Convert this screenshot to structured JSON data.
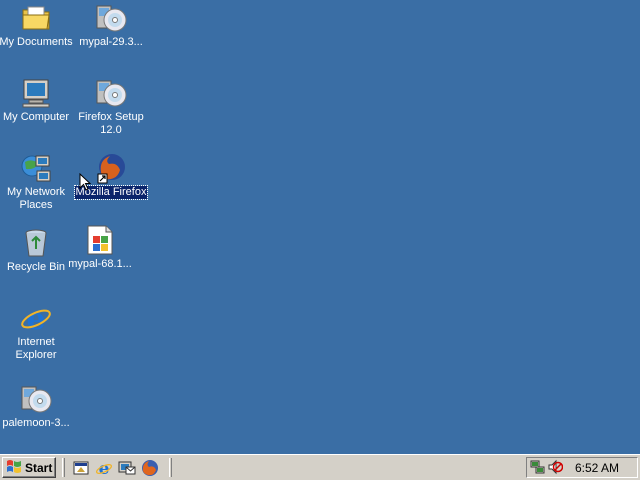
{
  "desktop": {
    "background_color": "#3a6ea5",
    "icons": [
      {
        "label": "My Documents",
        "icon": "folder-documents-icon"
      },
      {
        "label": "mypal-29.3...",
        "icon": "installer-cd-icon"
      },
      {
        "label": "My Computer",
        "icon": "computer-monitor-icon"
      },
      {
        "label": "Firefox Setup 12.0",
        "icon": "installer-cd-icon"
      },
      {
        "label": "My Network Places",
        "icon": "network-places-icon"
      },
      {
        "label": "Mozilla Firefox",
        "icon": "firefox-shortcut-icon",
        "selected": true
      },
      {
        "label": "Recycle Bin",
        "icon": "recycle-bin-icon"
      },
      {
        "label": "mypal-68.1...",
        "icon": "windows-installer-file-icon"
      },
      {
        "label": "Internet Explorer",
        "icon": "internet-explorer-icon"
      },
      {
        "label": "palemoon-3...",
        "icon": "installer-cd-icon"
      }
    ]
  },
  "taskbar": {
    "start_label": "Start",
    "quick_launch": [
      "show-desktop-icon",
      "internet-explorer-icon",
      "outlook-express-icon",
      "firefox-icon"
    ],
    "tray_icons": [
      "network-connection-icon",
      "volume-muted-icon"
    ],
    "clock": "6:52 AM"
  }
}
